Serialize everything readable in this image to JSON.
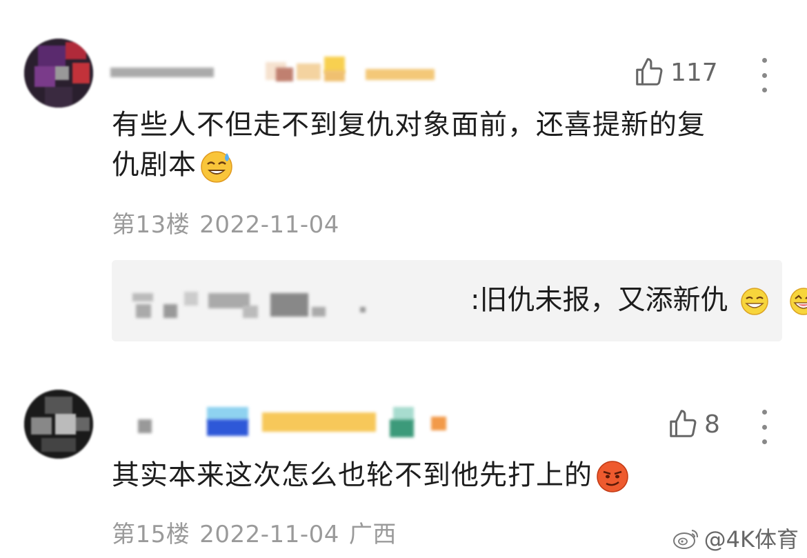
{
  "comments": [
    {
      "likes": "117",
      "text_line1": "有些人不但走不到复仇对象面前，还喜提新的复",
      "text_line2": "仇剧本",
      "floor": "第13楼",
      "date": "2022-11-04",
      "location": "",
      "emoji": "sweat-smile-emoji",
      "reply": {
        "text": ":旧仇未报，又添新仇"
      }
    },
    {
      "likes": "8",
      "text_line1": "其实本来这次怎么也轮不到他先打上的",
      "floor": "第15楼",
      "date": "2022-11-04",
      "location": "广西",
      "emoji": "smirk-emoji"
    }
  ],
  "watermark": {
    "handle": "@4K体育",
    "icon": "weibo-logo-icon"
  },
  "colors": {
    "meta_gray": "#9a9a9a",
    "reply_bg": "#f3f3f3",
    "text": "#1d1d1d"
  }
}
